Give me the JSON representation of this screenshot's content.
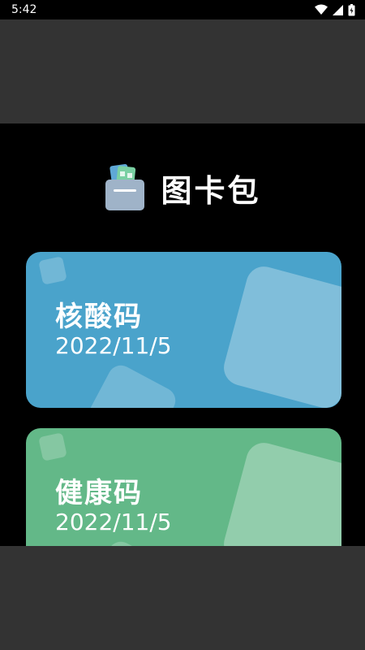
{
  "status_bar": {
    "time": "5:42",
    "icons": [
      "wifi-icon",
      "signal-icon",
      "battery-icon"
    ]
  },
  "header": {
    "title": "图卡包",
    "logo_icon": "card-wallet-icon"
  },
  "cards": [
    {
      "title": "核酸码",
      "date": "2022/11/5",
      "color": "#4aa3cb"
    },
    {
      "title": "健康码",
      "date": "2022/11/5",
      "color": "#63b888"
    }
  ],
  "colors": {
    "background": "#000000",
    "overlay_band": "#333333",
    "text": "#ffffff"
  }
}
